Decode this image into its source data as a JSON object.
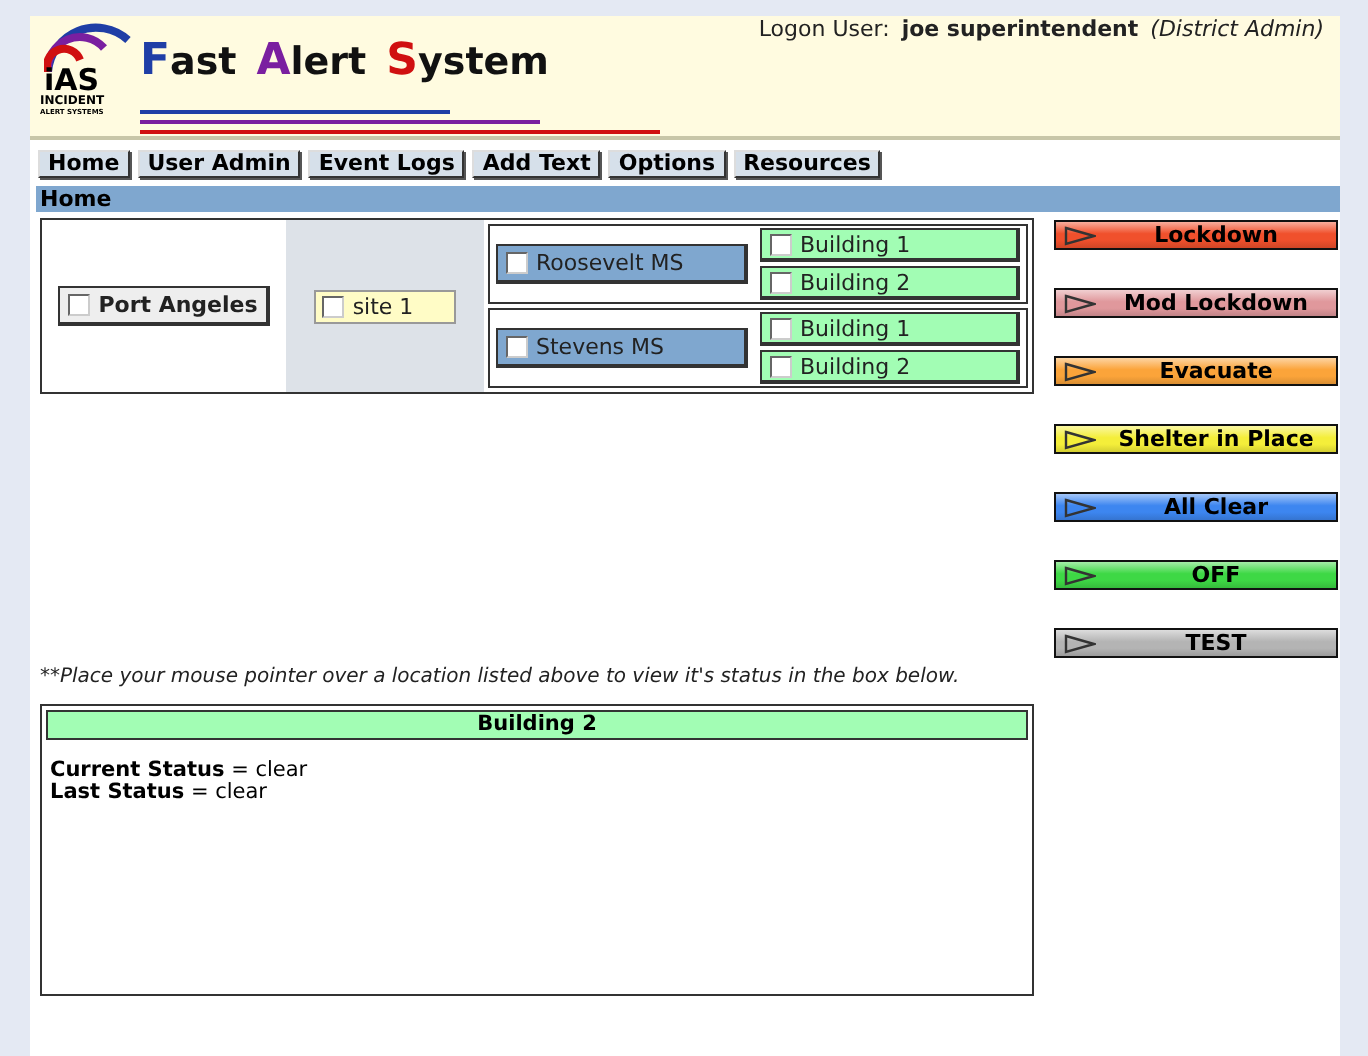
{
  "header": {
    "logon": "Logon User:",
    "user": "joe superintendent",
    "role": "(District Admin)",
    "logo": {
      "mark": "iAS",
      "line1": "INCIDENT",
      "line2": "ALERT SYSTEMS"
    },
    "title": [
      {
        "initial": "F",
        "rest": "ast",
        "color": "#1f3ea6"
      },
      {
        "initial": "A",
        "rest": "lert",
        "color": "#7a1fa0"
      },
      {
        "initial": "S",
        "rest": "ystem",
        "color": "#d01010"
      }
    ]
  },
  "nav": [
    "Home",
    "User Admin",
    "Event Logs",
    "Add Text",
    "Options",
    "Resources"
  ],
  "section_title": "Home",
  "district": {
    "name": "Port Angeles",
    "checked": false,
    "site": {
      "name": "site 1",
      "checked": false,
      "schools": [
        {
          "name": "Roosevelt MS",
          "checked": false,
          "children": [
            {
              "name": "Building 1",
              "checked": false
            },
            {
              "name": "Building 2",
              "checked": false
            }
          ]
        },
        {
          "name": "Stevens MS",
          "checked": false,
          "children": [
            {
              "name": "Building 1",
              "checked": false
            },
            {
              "name": "Building 2",
              "checked": false
            }
          ]
        }
      ]
    }
  },
  "actions": [
    {
      "label": "Lockdown",
      "color": "#f0502c"
    },
    {
      "label": "Mod Lockdown",
      "color": "#e0989c"
    },
    {
      "label": "Evacuate",
      "color": "#fba43a"
    },
    {
      "label": "Shelter in Place",
      "color": "#f4ee3a"
    },
    {
      "label": "All Clear",
      "color": "#3d86f0"
    },
    {
      "label": "OFF",
      "color": "#3ed845"
    },
    {
      "label": "TEST",
      "color": "#b4b4b4"
    }
  ],
  "hint": "**Place your mouse pointer over a location listed above to view it's status in the box below.",
  "status": {
    "title": "Building 2",
    "lines": [
      "**Current Status** = clear",
      "**Last Status** = clear"
    ]
  }
}
